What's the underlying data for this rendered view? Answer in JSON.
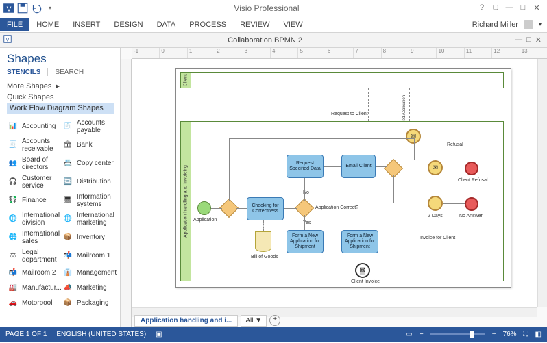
{
  "app": {
    "title": "Visio Professional"
  },
  "ribbon": {
    "file": "FILE",
    "tabs": [
      "HOME",
      "INSERT",
      "DESIGN",
      "DATA",
      "PROCESS",
      "REVIEW",
      "VIEW"
    ],
    "user": "Richard Miller"
  },
  "doc": {
    "title": "Collaboration BPMN 2"
  },
  "sidebar": {
    "heading": "Shapes",
    "tab_stencils": "STENCILS",
    "tab_search": "SEARCH",
    "more": "More Shapes",
    "quick": "Quick Shapes",
    "stencil": "Work Flow Diagram Shapes",
    "shapes": [
      {
        "l": "Accounting"
      },
      {
        "l": "Accounts payable"
      },
      {
        "l": "Accounts receivable"
      },
      {
        "l": "Bank"
      },
      {
        "l": "Board of directors"
      },
      {
        "l": "Copy center"
      },
      {
        "l": "Customer service"
      },
      {
        "l": "Distribution"
      },
      {
        "l": "Finance"
      },
      {
        "l": "Information systems"
      },
      {
        "l": "International division"
      },
      {
        "l": "International marketing"
      },
      {
        "l": "International sales"
      },
      {
        "l": "Inventory"
      },
      {
        "l": "Legal department"
      },
      {
        "l": "Mailroom 1"
      },
      {
        "l": "Mailroom 2"
      },
      {
        "l": "Management"
      },
      {
        "l": "Manufactur..."
      },
      {
        "l": "Marketing"
      },
      {
        "l": "Motorpool"
      },
      {
        "l": "Packaging"
      }
    ]
  },
  "ruler": [
    "-1",
    "0",
    "1",
    "2",
    "3",
    "4",
    "5",
    "6",
    "7",
    "8",
    "9",
    "10",
    "11",
    "12",
    "13"
  ],
  "diagram": {
    "pool_client": "Client",
    "pool_main": "Application handling and Invoicing",
    "start_lbl": "Application",
    "task_check": "Checking for Correctness",
    "task_request": "Request Specified Data",
    "task_email": "Email Client",
    "task_form1": "Form a New Application for Shipment",
    "task_form2": "Form a New Application for Shipment",
    "lbl_reqclient": "Request to Client",
    "lbl_appcorrect": "Application Correct?",
    "lbl_no": "No",
    "lbl_yes": "Yes",
    "lbl_refusal": "Refusal",
    "lbl_clientrefusal": "Client Refusal",
    "lbl_2days": "2 Days",
    "lbl_noanswer": "No Answer",
    "lbl_invoice": "Invoice for Client",
    "lbl_clientinvoice": "Client Invoice",
    "lbl_billgoods": "Bill of Goods",
    "lbl_specapp": "Specified Application"
  },
  "sheettabs": {
    "active": "Application handling and i...",
    "all": "All"
  },
  "status": {
    "page": "PAGE 1 OF 1",
    "lang": "ENGLISH (UNITED STATES)",
    "zoom": "76%"
  }
}
